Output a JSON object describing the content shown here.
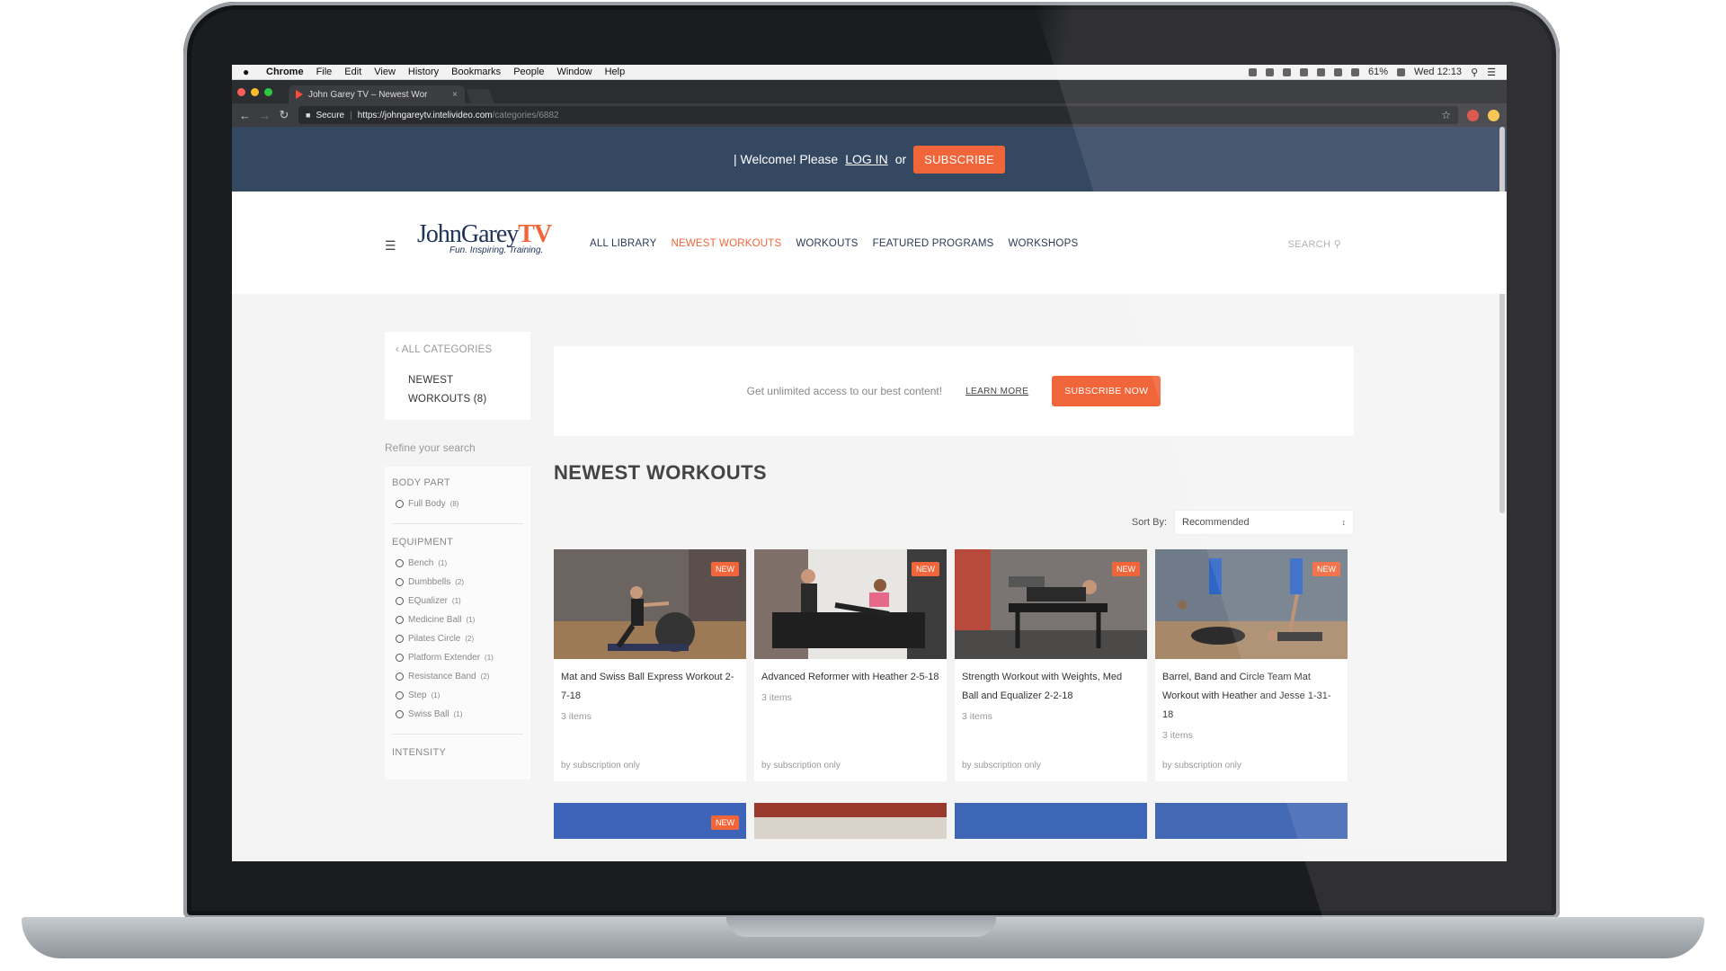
{
  "macbar": {
    "app": "Chrome",
    "menus": [
      "File",
      "Edit",
      "View",
      "History",
      "Bookmarks",
      "People",
      "Window",
      "Help"
    ],
    "battery": "61%",
    "clock": "Wed 12:13"
  },
  "browser": {
    "tab_title": "John Garey TV – Newest Wor",
    "tab_close": "×",
    "secure_label": "Secure",
    "url_host": "https://johngareytv.intelivideo.com",
    "url_path": "/categories/6882"
  },
  "welcome": {
    "prefix": "| Welcome! Please",
    "login": "LOG IN",
    "or": "or",
    "subscribe": "SUBSCRIBE"
  },
  "header": {
    "logo_name_a": "JohnGarey",
    "logo_name_b": "TV",
    "logo_tagline": "Fun. Inspiring. Training.",
    "nav": [
      {
        "label": "ALL LIBRARY"
      },
      {
        "label": "NEWEST WORKOUTS"
      },
      {
        "label": "WORKOUTS"
      },
      {
        "label": "FEATURED PROGRAMS"
      },
      {
        "label": "WORKSHOPS"
      }
    ],
    "search": "SEARCH"
  },
  "sidebar": {
    "back": "ALL CATEGORIES",
    "current_line1": "NEWEST",
    "current_line2": "WORKOUTS (8)",
    "refine": "Refine your search",
    "body_part_title": "BODY PART",
    "body_part": [
      {
        "label": "Full Body",
        "count": "(8)"
      }
    ],
    "equipment_title": "EQUIPMENT",
    "equipment": [
      {
        "label": "Bench",
        "count": "(1)"
      },
      {
        "label": "Dumbbells",
        "count": "(2)"
      },
      {
        "label": "EQualizer",
        "count": "(1)"
      },
      {
        "label": "Medicine Ball",
        "count": "(1)"
      },
      {
        "label": "Pilates Circle",
        "count": "(2)"
      },
      {
        "label": "Platform Extender",
        "count": "(1)"
      },
      {
        "label": "Resistance Band",
        "count": "(2)"
      },
      {
        "label": "Step",
        "count": "(1)"
      },
      {
        "label": "Swiss Ball",
        "count": "(1)"
      }
    ],
    "intensity_title": "INTENSITY"
  },
  "promo": {
    "text": "Get unlimited access to our best content!",
    "learn": "LEARN MORE",
    "subscribe_now": "SUBSCRIBE NOW"
  },
  "section": {
    "title": "NEWEST WORKOUTS",
    "sort_label": "Sort By:",
    "sort_value": "Recommended"
  },
  "cards": [
    {
      "title": "Mat and Swiss Ball Express Workout 2-7-18",
      "count": "3 items",
      "sub": "by subscription only",
      "badge": "NEW"
    },
    {
      "title": "Advanced Reformer with Heather 2-5-18",
      "count": "3 items",
      "sub": "by subscription only",
      "badge": "NEW"
    },
    {
      "title": "Strength Workout with Weights, Med Ball and Equalizer 2-2-18",
      "count": "3 items",
      "sub": "by subscription only",
      "badge": "NEW"
    },
    {
      "title": "Barrel, Band and Circle Team Mat Workout with Heather and Jesse 1-31-18",
      "count": "3 items",
      "sub": "by subscription only",
      "badge": "NEW"
    }
  ],
  "cards_row2_badge": "NEW",
  "colors": {
    "accent": "#f0663a",
    "navy": "#354862",
    "brand_blue": "#20335a"
  }
}
